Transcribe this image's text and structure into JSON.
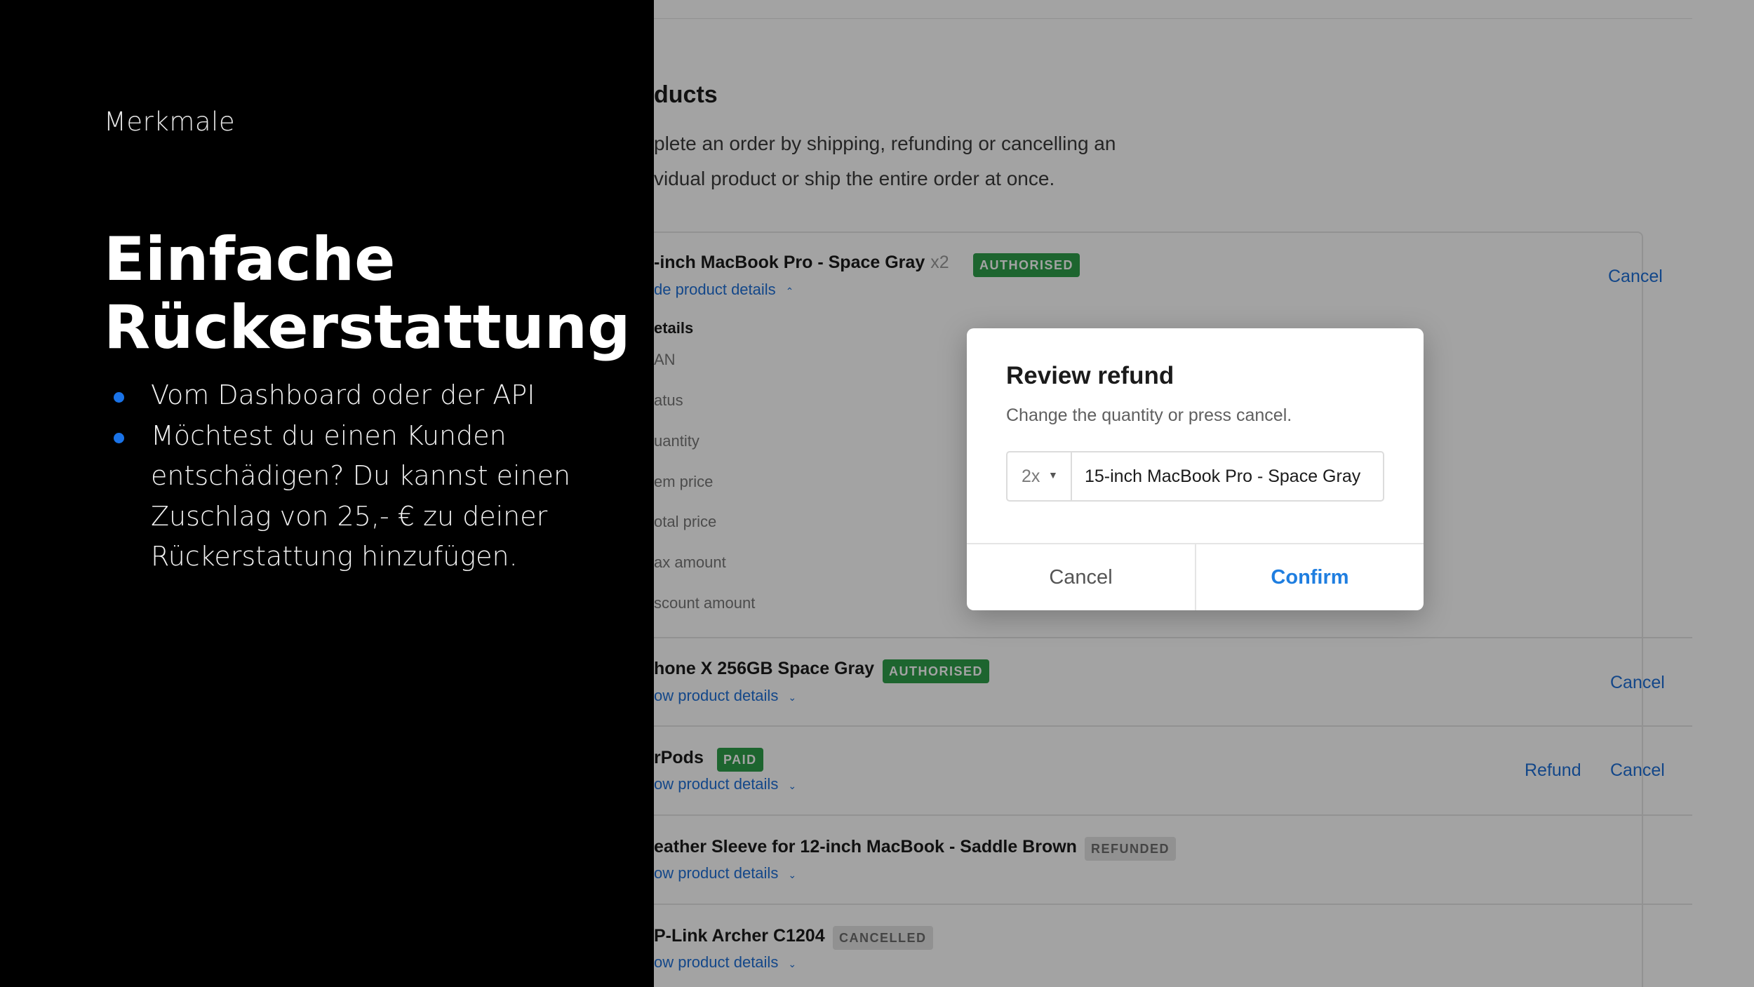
{
  "slide": {
    "eyebrow": "Merkmale",
    "headline_line1": "Einfache",
    "headline_line2": "Rückerstattung",
    "bullets": [
      "Vom Dashboard oder der API",
      "Möchtest du einen Kunden entschädigen? Du kannst einen Zuschlag von 25,- € zu deiner Rückerstattung hinzufügen."
    ],
    "bullet_color": "#1a73e8"
  },
  "dashboard": {
    "section_title": "ducts",
    "description_line1": "plete an order by shipping, refunding or cancelling an",
    "description_line2": "vidual product or ship the entire order at once.",
    "products": [
      {
        "name": "-inch MacBook Pro - Space Gray",
        "quantity": "x2",
        "status": "AUTHORISED",
        "link": "de product details",
        "link_chevron": "⌃",
        "actions": [
          "Cancel"
        ]
      },
      {
        "name": "hone X 256GB Space Gray",
        "quantity": "",
        "status": "AUTHORISED",
        "link": "ow product details",
        "link_chevron": "⌄",
        "actions": [
          "Cancel"
        ]
      },
      {
        "name": "rPods",
        "quantity": "",
        "status": "PAID",
        "link": "ow product details",
        "link_chevron": "⌄",
        "actions": [
          "Refund",
          "Cancel"
        ]
      },
      {
        "name": "eather Sleeve for 12-inch MacBook - Saddle Brown",
        "quantity": "",
        "status": "REFUNDED",
        "link": "ow product details",
        "link_chevron": "⌄",
        "actions": []
      },
      {
        "name": "P-Link Archer C1204",
        "quantity": "",
        "status": "CANCELLED",
        "link": "ow product details",
        "link_chevron": "⌄",
        "actions": []
      }
    ],
    "details_title": "etails",
    "detail_labels": [
      "AN",
      "atus",
      "uantity",
      "em price",
      "otal price",
      "ax amount",
      "scount amount"
    ],
    "colors": {
      "authorised": "#2e9e4a",
      "paid": "#2e9e4a",
      "muted_badge": "#e3e3e3",
      "link": "#1f6fd6"
    }
  },
  "modal": {
    "title": "Review refund",
    "subtitle": "Change the quantity or press cancel.",
    "quantity": "2x",
    "product": "15-inch MacBook Pro - Space Gray",
    "cancel_label": "Cancel",
    "confirm_label": "Confirm",
    "confirm_color": "#1f7ee0"
  }
}
